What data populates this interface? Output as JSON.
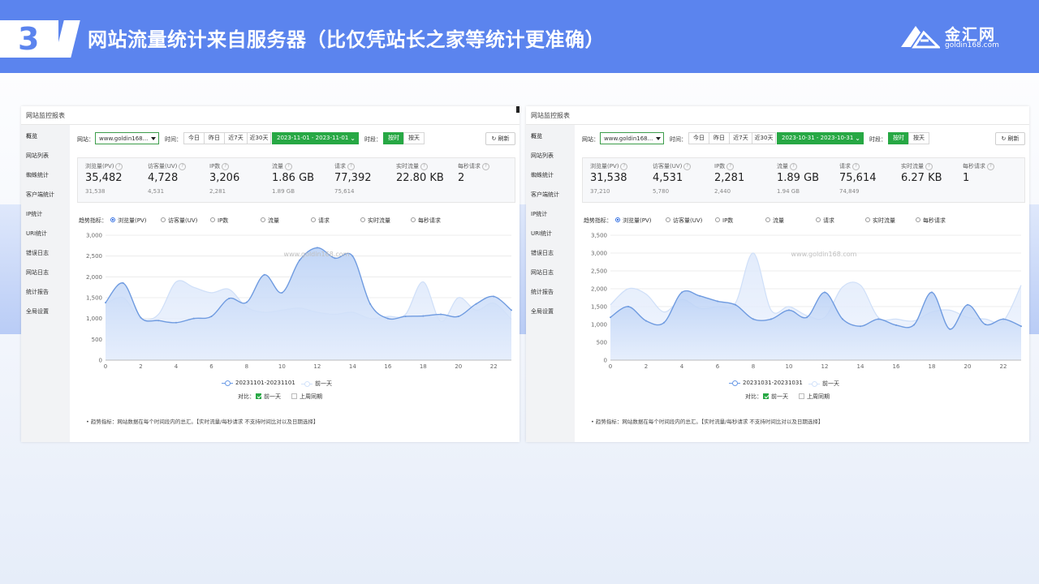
{
  "slide": {
    "number": "3",
    "title": "网站流量统计来自服务器（比仅凭站长之家等统计更准确）",
    "logo_name": "金汇网",
    "logo_url": "goldin168.com",
    "brand_color": "#5b84ee"
  },
  "panels": [
    {
      "title": "网站监控报表",
      "sidebar": [
        "概览",
        "网站列表",
        "蜘蛛统计",
        "客户端统计",
        "IP统计",
        "URI统计",
        "错误日志",
        "网站日志",
        "统计报告",
        "全局设置"
      ],
      "toolbar": {
        "site_label": "网站：",
        "site_value": "www.goldin168...",
        "time_label": "时间：",
        "range_buttons": [
          "今日",
          "昨日",
          "近7天",
          "近30天"
        ],
        "date_range": "2023-11-01 - 2023-11-01",
        "period_label": "时段：",
        "period_buttons": [
          "按时",
          "按天"
        ],
        "refresh": "刷新"
      },
      "stats": [
        {
          "label": "浏览量(PV)",
          "value": "35,482",
          "prev": "31,538"
        },
        {
          "label": "访客量(UV)",
          "value": "4,728",
          "prev": "4,531"
        },
        {
          "label": "IP数",
          "value": "3,206",
          "prev": "2,281"
        },
        {
          "label": "流量",
          "value": "1.86 GB",
          "prev": "1.89 GB"
        },
        {
          "label": "请求",
          "value": "77,392",
          "prev": "75,614"
        },
        {
          "label": "实时流量",
          "value": "22.80 KB",
          "prev": ""
        },
        {
          "label": "每秒请求",
          "value": "2",
          "prev": ""
        }
      ],
      "trend_label": "趋势指标：",
      "metrics": [
        "浏览量(PV)",
        "访客量(UV)",
        "IP数",
        "流量",
        "请求",
        "实时流量",
        "每秒请求"
      ],
      "watermark": "www.goldin168.com",
      "compare_label": "对比：",
      "compare_options": [
        "前一天",
        "上周同期"
      ],
      "note": "•  趋势指标：网站数据在每个时间段内的总汇。【实时流量/每秒请求 不支持时间比对以及日期选择】",
      "chart_data": {
        "type": "area",
        "x": [
          0,
          1,
          2,
          3,
          4,
          5,
          6,
          7,
          8,
          9,
          10,
          11,
          12,
          13,
          14,
          15,
          16,
          17,
          18,
          19,
          20,
          21,
          22,
          23
        ],
        "xticks": [
          "0",
          "2",
          "4",
          "6",
          "8",
          "10",
          "12",
          "14",
          "16",
          "18",
          "20",
          "22"
        ],
        "yticks": [
          "0",
          "500",
          "1,000",
          "1,500",
          "2,000",
          "2,500",
          "3,000"
        ],
        "ylim": [
          0,
          3000
        ],
        "series": [
          {
            "name": "20231101-20231101",
            "values": [
              1380,
              1850,
              1020,
              950,
              900,
              1000,
              1050,
              1480,
              1390,
              2050,
              1620,
              2400,
              2700,
              2450,
              2500,
              1350,
              1000,
              1050,
              1060,
              1100,
              1050,
              1350,
              1530,
              1200
            ]
          },
          {
            "name": "前一天",
            "values": [
              1350,
              1500,
              1000,
              1100,
              1880,
              1750,
              1620,
              1700,
              1270,
              1150,
              1200,
              1250,
              1150,
              1100,
              1150,
              1000,
              1050,
              1100,
              1880,
              930,
              1500,
              1200,
              1370,
              980
            ]
          }
        ]
      }
    },
    {
      "title": "网站监控报表",
      "sidebar": [
        "概览",
        "网站列表",
        "蜘蛛统计",
        "客户端统计",
        "IP统计",
        "URI统计",
        "错误日志",
        "网站日志",
        "统计报告",
        "全局设置"
      ],
      "toolbar": {
        "site_label": "网站：",
        "site_value": "www.goldin168...",
        "time_label": "时间：",
        "range_buttons": [
          "今日",
          "昨日",
          "近7天",
          "近30天"
        ],
        "date_range": "2023-10-31 - 2023-10-31",
        "period_label": "时段：",
        "period_buttons": [
          "按时",
          "按天"
        ],
        "refresh": "刷新"
      },
      "stats": [
        {
          "label": "浏览量(PV)",
          "value": "31,538",
          "prev": "37,210"
        },
        {
          "label": "访客量(UV)",
          "value": "4,531",
          "prev": "5,780"
        },
        {
          "label": "IP数",
          "value": "2,281",
          "prev": "2,440"
        },
        {
          "label": "流量",
          "value": "1.89 GB",
          "prev": "1.94 GB"
        },
        {
          "label": "请求",
          "value": "75,614",
          "prev": "74,849"
        },
        {
          "label": "实时流量",
          "value": "6.27 KB",
          "prev": ""
        },
        {
          "label": "每秒请求",
          "value": "1",
          "prev": ""
        }
      ],
      "trend_label": "趋势指标：",
      "metrics": [
        "浏览量(PV)",
        "访客量(UV)",
        "IP数",
        "流量",
        "请求",
        "实时流量",
        "每秒请求"
      ],
      "watermark": "www.goldin168.com",
      "compare_label": "对比：",
      "compare_options": [
        "前一天",
        "上周同期"
      ],
      "note": "•  趋势指标：网站数据在每个时间段内的总汇。【实时流量/每秒请求 不支持时间比对以及日期选择】",
      "chart_data": {
        "type": "area",
        "x": [
          0,
          1,
          2,
          3,
          4,
          5,
          6,
          7,
          8,
          9,
          10,
          11,
          12,
          13,
          14,
          15,
          16,
          17,
          18,
          19,
          20,
          21,
          22,
          23
        ],
        "xticks": [
          "0",
          "2",
          "4",
          "6",
          "8",
          "10",
          "12",
          "14",
          "16",
          "18",
          "20",
          "22"
        ],
        "yticks": [
          "0",
          "500",
          "1,000",
          "1,500",
          "2,000",
          "2,500",
          "3,000",
          "3,500"
        ],
        "ylim": [
          0,
          3500
        ],
        "series": [
          {
            "name": "20231031-20231031",
            "values": [
              1200,
              1500,
              1100,
              1050,
              1900,
              1800,
              1650,
              1550,
              1150,
              1150,
              1400,
              1200,
              1900,
              1150,
              950,
              1150,
              980,
              990,
              1900,
              870,
              1550,
              1000,
              1150,
              950
            ]
          },
          {
            "name": "前一天",
            "values": [
              1550,
              2000,
              1850,
              1350,
              1700,
              1450,
              1500,
              1600,
              3000,
              1400,
              1500,
              1250,
              1200,
              2050,
              2100,
              1200,
              1150,
              1100,
              1350,
              1400,
              1200,
              1150,
              1100,
              2100
            ]
          }
        ]
      }
    }
  ]
}
